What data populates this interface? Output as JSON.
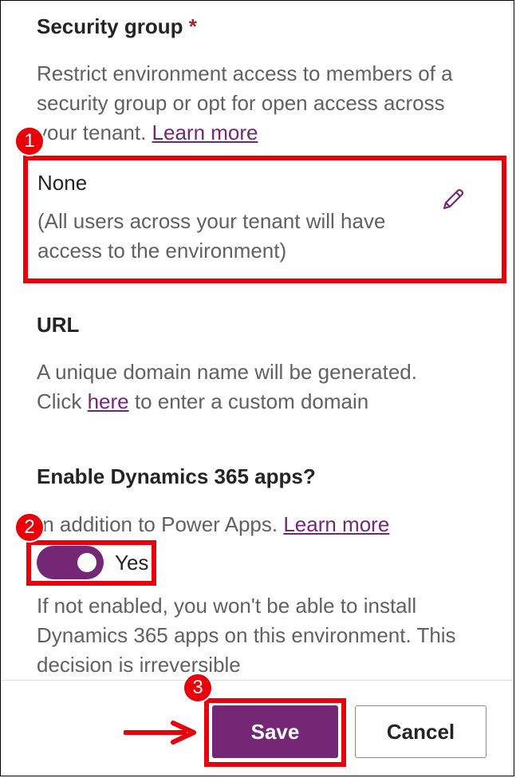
{
  "security_group": {
    "title": "Security group",
    "required_mark": "*",
    "description": "Restrict environment access to members of a security group or opt for open access across your tenant.",
    "learn_more": "Learn more",
    "value": "None",
    "note": "(All users across your tenant will have access to the environment)"
  },
  "url": {
    "title": "URL",
    "line1": "A unique domain name will be generated.",
    "click_prefix": "Click",
    "here_link": "here",
    "click_suffix": "to enter a custom domain"
  },
  "dynamics": {
    "title": "Enable Dynamics 365 apps?",
    "description": "In addition to Power Apps.",
    "learn_more": "Learn more",
    "toggle_label": "Yes",
    "toggle_on": true,
    "warning": "If not enabled, you won't be able to install Dynamics 365 apps on this environment. This decision is irreversible"
  },
  "footer": {
    "save_label": "Save",
    "cancel_label": "Cancel"
  },
  "annotations": {
    "step1": "1",
    "step2": "2",
    "step3": "3",
    "color": "#e8000b"
  },
  "colors": {
    "accent": "#742774",
    "link": "#742774",
    "text_muted": "#616161"
  }
}
